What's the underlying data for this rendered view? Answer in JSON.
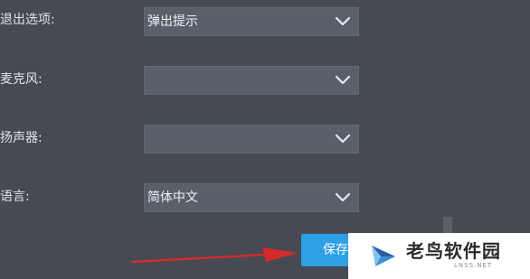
{
  "settings": {
    "rows": [
      {
        "label": "退出选项:",
        "value": "弹出提示"
      },
      {
        "label": "麦克风:",
        "value": ""
      },
      {
        "label": "扬声器:",
        "value": ""
      },
      {
        "label": "语言:",
        "value": "简体中文"
      }
    ],
    "save_label": "保存"
  },
  "watermark": {
    "title": "老鸟软件园",
    "subtitle": "LNSS.NET"
  },
  "colors": {
    "background": "#454a53",
    "select_bg": "#5a606b",
    "save_button": "#2f9fe6",
    "arrow": "#d62a2a"
  },
  "icons": {
    "dropdown": "chevron-down-icon",
    "annotation": "red-arrow",
    "watermark_logo": "bird-logo"
  }
}
